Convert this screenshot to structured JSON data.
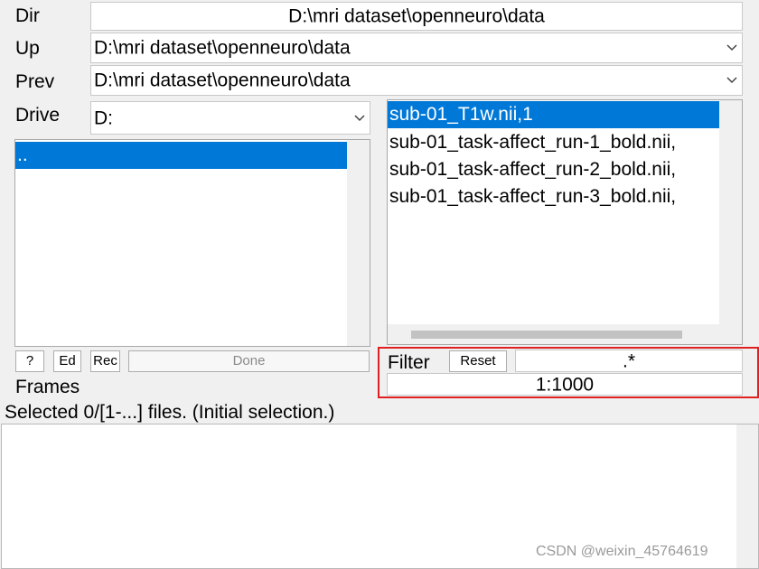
{
  "dir": {
    "label": "Dir",
    "value": "D:\\mri dataset\\openneuro\\data"
  },
  "up": {
    "label": "Up",
    "value": "D:\\mri dataset\\openneuro\\data",
    "icon": "chevron-down-icon"
  },
  "prev": {
    "label": "Prev",
    "value": "D:\\mri dataset\\openneuro\\data",
    "icon": "chevron-down-icon"
  },
  "drive": {
    "label": "Drive",
    "value": "D:",
    "icon": "chevron-down-icon"
  },
  "dir_list": {
    "items": [
      ".."
    ],
    "selected_index": 0
  },
  "file_list": {
    "items": [
      "sub-01_T1w.nii,1",
      "sub-01_task-affect_run-1_bold.nii,",
      "sub-01_task-affect_run-2_bold.nii,",
      "sub-01_task-affect_run-3_bold.nii,"
    ],
    "selected_index": 0
  },
  "buttons": {
    "help": "?",
    "ed": "Ed",
    "rec": "Rec",
    "done": "Done",
    "reset": "Reset"
  },
  "filter": {
    "label": "Filter",
    "value": ".*"
  },
  "frames": {
    "label": "Frames",
    "value": "1:1000"
  },
  "status_text": "Selected 0/[1-...] files. (Initial selection.)",
  "watermark": "CSDN @weixin_45764619",
  "colors": {
    "selection": "#0078d7",
    "highlight_border": "#e02020",
    "background": "#f0f0f0"
  }
}
